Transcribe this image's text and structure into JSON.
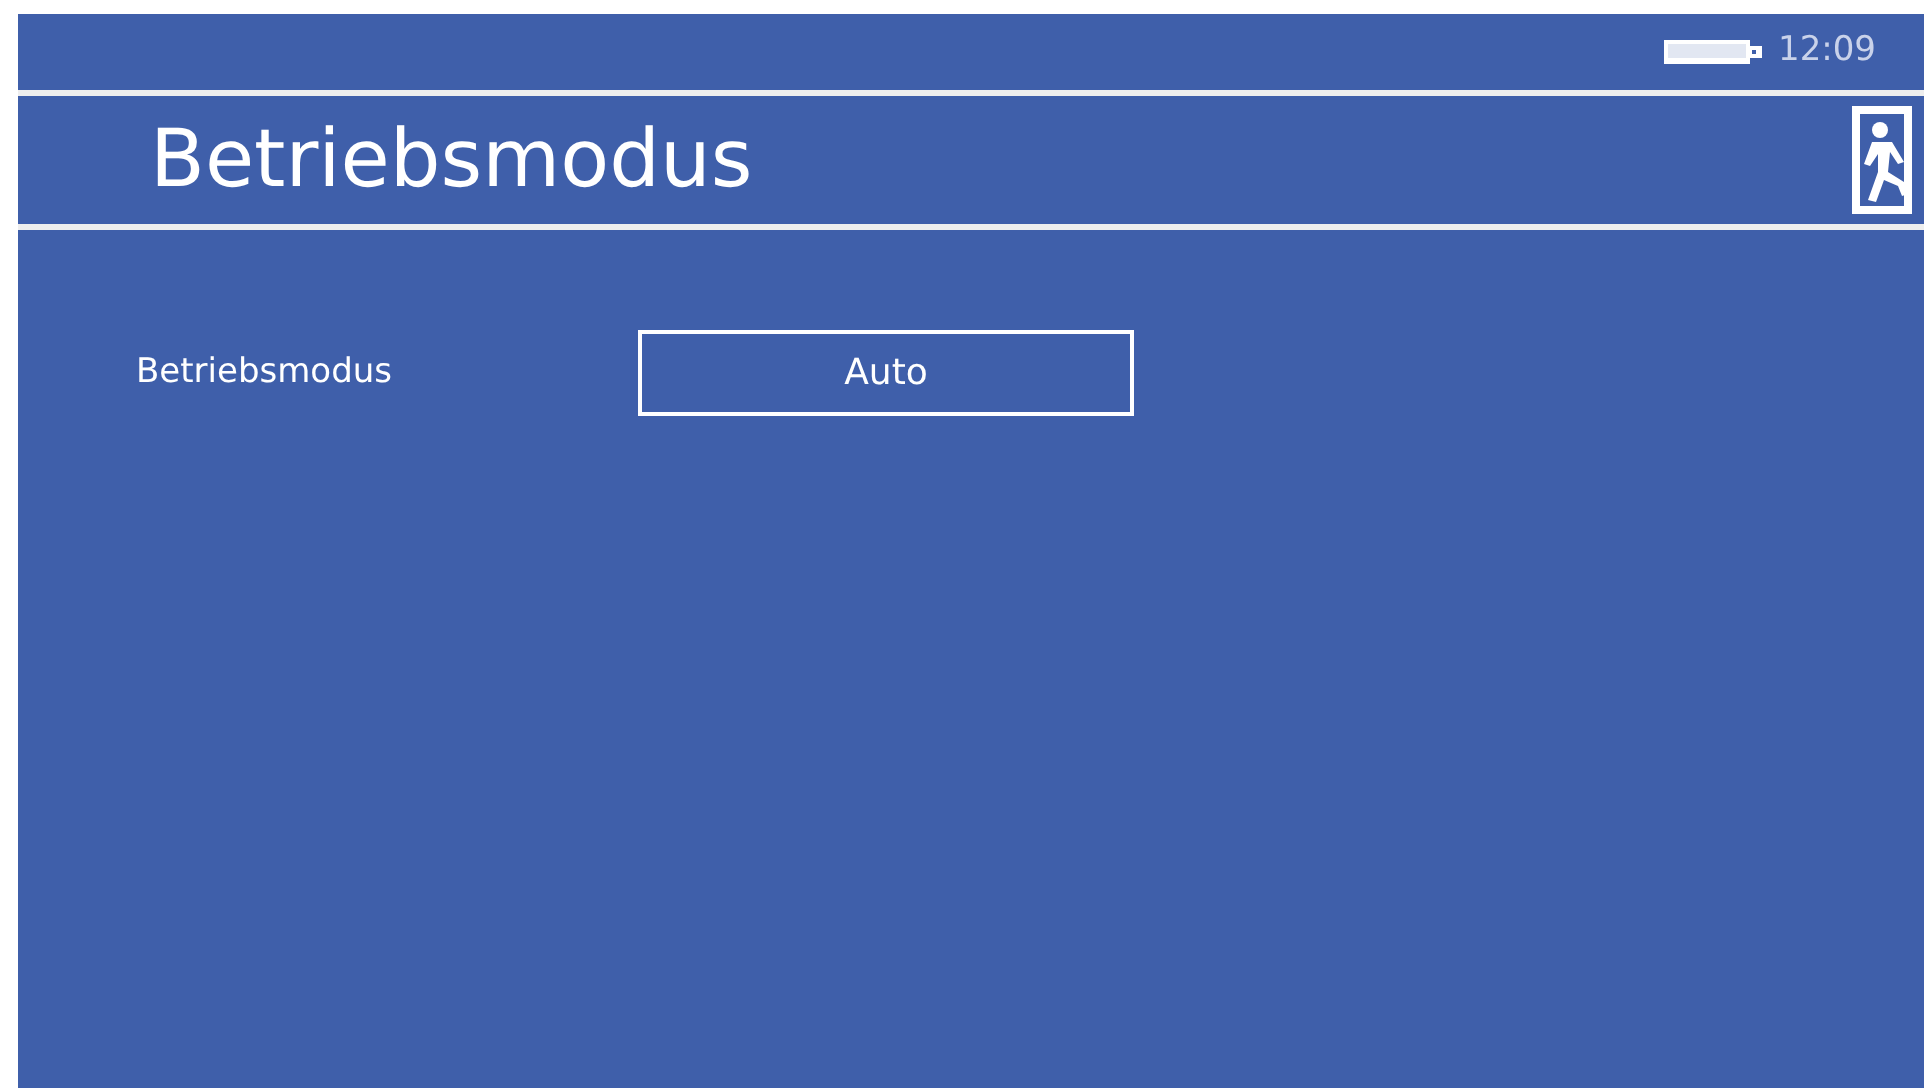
{
  "status_bar": {
    "time": "12:09"
  },
  "header": {
    "title": "Betriebsmodus"
  },
  "settings": [
    {
      "label": "Betriebsmodus",
      "value": "Auto"
    }
  ]
}
